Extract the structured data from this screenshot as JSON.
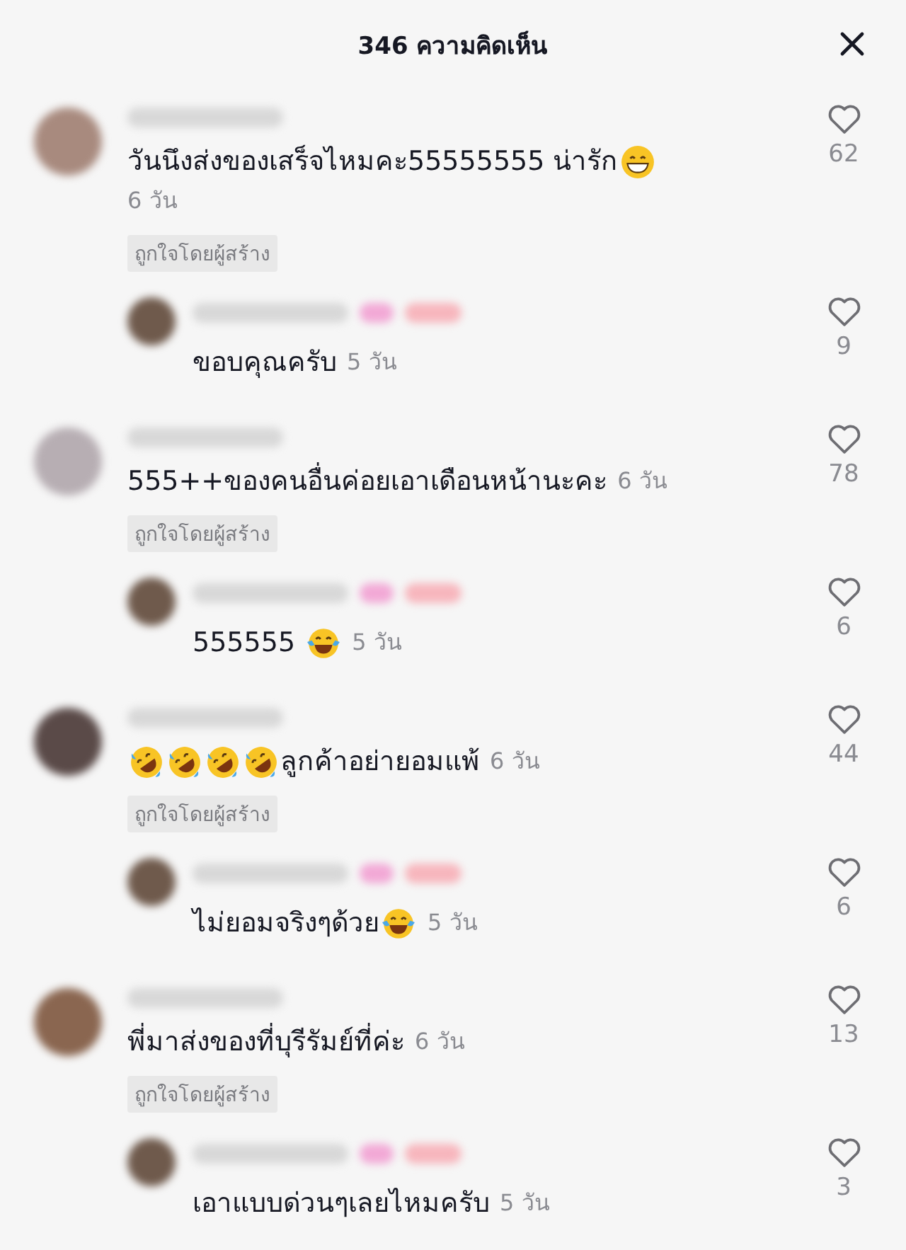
{
  "header": {
    "title": "346 ความคิดเห็น"
  },
  "comments": [
    {
      "parts": [
        {
          "kind": "text",
          "text": "วันนึงส่งของเสร็จไหมคะ55555555 น่ารัก"
        },
        {
          "kind": "grin"
        }
      ],
      "time": "6 วัน",
      "badge": "ถูกใจโดยผู้สร้าง",
      "likes": "62",
      "reply": {
        "parts": [
          {
            "kind": "text",
            "text": "ขอบคุณครับ"
          }
        ],
        "time": "5 วัน",
        "likes": "9"
      }
    },
    {
      "parts": [
        {
          "kind": "text",
          "text": "555++ของคนอื่นค่อยเอาเดือนหน้านะคะ"
        }
      ],
      "time": "6 วัน",
      "badge": "ถูกใจโดยผู้สร้าง",
      "likes": "78",
      "reply": {
        "parts": [
          {
            "kind": "text",
            "text": "555555 "
          },
          {
            "kind": "laugh-tears"
          }
        ],
        "time": "5 วัน",
        "likes": "6"
      }
    },
    {
      "parts": [
        {
          "kind": "rofl"
        },
        {
          "kind": "rofl"
        },
        {
          "kind": "rofl"
        },
        {
          "kind": "rofl"
        },
        {
          "kind": "text",
          "text": "ลูกค้าอย่ายอมแพ้"
        }
      ],
      "time": "6 วัน",
      "badge": "ถูกใจโดยผู้สร้าง",
      "likes": "44",
      "reply": {
        "parts": [
          {
            "kind": "text",
            "text": "ไม่ยอมจริงๆด้วย"
          },
          {
            "kind": "laugh-tears"
          }
        ],
        "time": "5 วัน",
        "likes": "6"
      }
    },
    {
      "parts": [
        {
          "kind": "text",
          "text": "พี่มาส่งของที่บุรีรัมย์ที่ค่ะ"
        }
      ],
      "time": "6 วัน",
      "badge": "ถูกใจโดยผู้สร้าง",
      "likes": "13",
      "reply": {
        "parts": [
          {
            "kind": "text",
            "text": "เอาแบบด่วนๆเลยไหมครับ"
          }
        ],
        "time": "5 วัน",
        "likes": "3"
      }
    }
  ]
}
